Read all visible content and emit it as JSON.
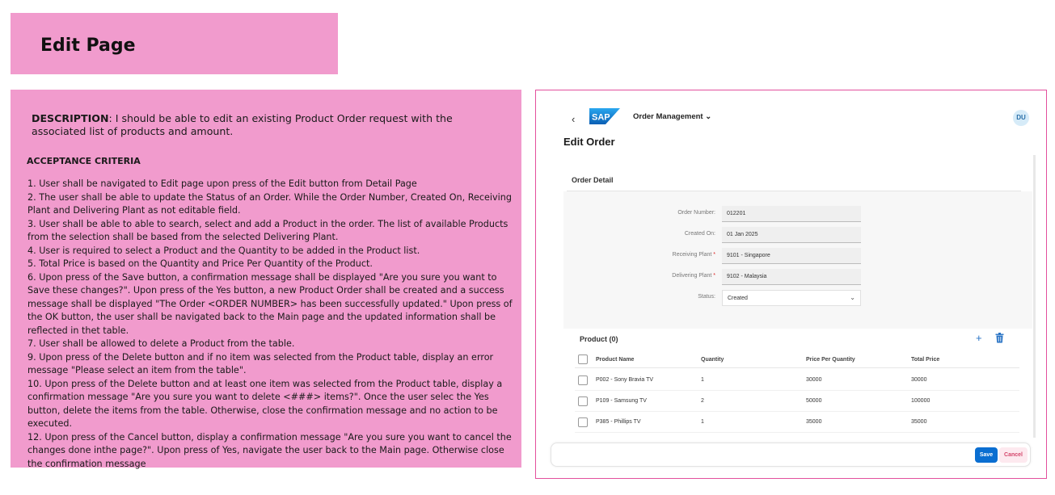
{
  "page": {
    "title": "Edit Page"
  },
  "description": {
    "label": "DESCRIPTION",
    "text": ": I should be able to edit an existing Product Order request with the associated list of products and amount.",
    "acceptance_title": "ACCEPTANCE CRITERIA",
    "criteria": [
      "1. User shall be navigated to Edit page upon press of the Edit button from Detail Page",
      "2. The user shall be able to update the Status of an Order. While the Order Number, Created On, Receiving Plant and Delivering Plant as not editable field.",
      "3. User shall be able to able to search, select and add a Product in the order. The list of available Products from the selection shall be based from the selected Delivering Plant.",
      "4.  User is required to select a Product and the Quantity to be added in the Product list.",
      "5. Total Price is based on the Quantity and Price Per Quantity of the Product.",
      "6. Upon press of the Save button, a confirmation message shall be displayed \"Are you sure you want to Save these changes?\". Upon press of the Yes button, a new Product Order shall be created and a success message shall be displayed \"The Order <ORDER NUMBER> has been successfully updated.\" Upon press of the OK button, the user shall be navigated back to the Main page and the updated information shall be reflected in thet table.",
      "7. User shall be allowed to delete a Product from the table.",
      "9. Upon press of the Delete button and if no item was selected from the Product table, display an error message \"Please select an item from the table\".",
      "10. Upon press of the Delete button and at least one item was selected from the Product table, display a confirmation message \"Are you sure you want to delete <###> items?\". Once the user selec the Yes button, delete the items from the table. Otherwise, close the confirmation message and no action to be executed.",
      "12. Upon press of the Cancel button, display a confirmation message \"Are you sure you want to cancel the changes done inthe page?\". Upon press of Yes, navigate the user back to the Main page. Otherwise close the confirmation message"
    ]
  },
  "mockup": {
    "back": "‹",
    "logo_text": "SAP",
    "app_title": "Order Management",
    "app_chevron": "⌄",
    "avatar": "DU",
    "page_title": "Edit Order",
    "section_title": "Order Detail",
    "fields": [
      {
        "label": "Order Number:",
        "value": "012201",
        "required": false
      },
      {
        "label": "Created On:",
        "value": "01 Jan 2025",
        "required": false
      },
      {
        "label": "Receiving Plant",
        "value": "9101 - Singapore",
        "required": true
      },
      {
        "label": "Delivering Plant",
        "value": "9102 - Malaysia",
        "required": true
      },
      {
        "label": "Status:",
        "value": "Created",
        "required": false
      }
    ],
    "required_mark": "*",
    "select_chevron": "⌄",
    "product_title": "Product (0)",
    "add_icon": "+",
    "columns": [
      "Product Name",
      "Quantity",
      "Price Per Quantity",
      "Total Price"
    ],
    "rows": [
      [
        "P002 - Sony Bravia TV",
        "1",
        "30000",
        "30000"
      ],
      [
        "P109 - Samsung TV",
        "2",
        "50000",
        "100000"
      ],
      [
        "P385 - Phillips TV",
        "1",
        "35000",
        "35000"
      ]
    ],
    "save_label": "Save",
    "cancel_label": "Cancel",
    "colors": {
      "accent_pink": "#f19bcd",
      "frame_border": "#e3509d",
      "sap_blue": "#0a6ed1"
    }
  }
}
